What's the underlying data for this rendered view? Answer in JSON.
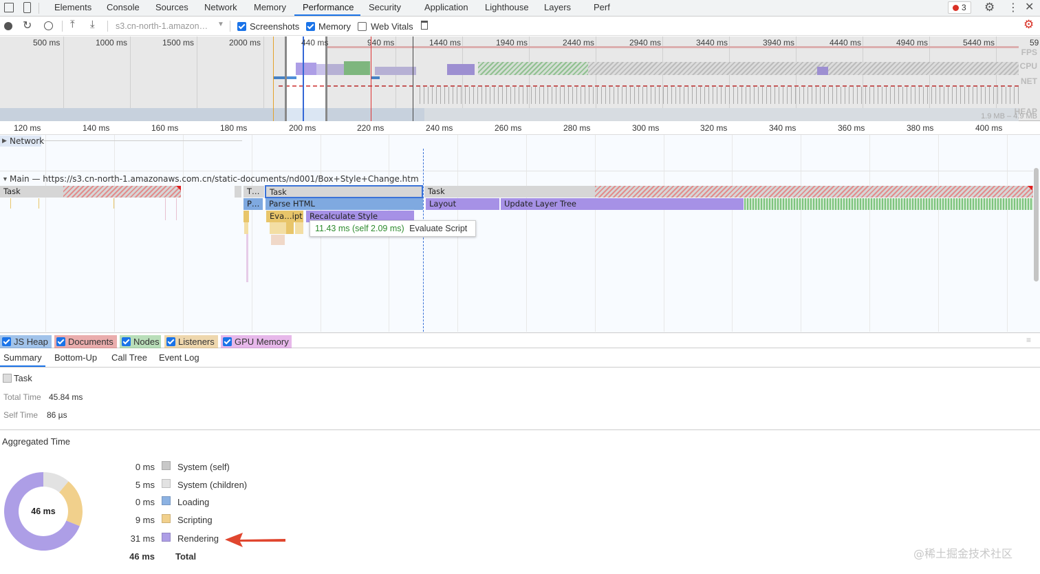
{
  "top_tabs": [
    "Elements",
    "Console",
    "Sources",
    "Network",
    "Memory",
    "Performance",
    "Security",
    "Application",
    "Lighthouse",
    "Layers",
    "Perf"
  ],
  "active_tab": "Performance",
  "error_count": "3",
  "toolbar": {
    "url_select": "s3.cn-north-1.amazon…",
    "screenshots_label": "Screenshots",
    "memory_label": "Memory",
    "web_vitals_label": "Web Vitals",
    "screenshots_checked": true,
    "memory_checked": true,
    "web_vitals_checked": false
  },
  "overview": {
    "ticks": [
      "500 ms",
      "1000 ms",
      "1500 ms",
      "2000 ms",
      "440 ms",
      "940 ms",
      "1440 ms",
      "1940 ms",
      "2440 ms",
      "2940 ms",
      "3440 ms",
      "3940 ms",
      "4440 ms",
      "4940 ms",
      "5440 ms",
      "59"
    ],
    "lanes": [
      "FPS",
      "CPU",
      "NET",
      "HEAP"
    ],
    "heap_range": "1.9 MB – 4.9 MB"
  },
  "ruler_ticks": [
    "120 ms",
    "140 ms",
    "160 ms",
    "180 ms",
    "200 ms",
    "220 ms",
    "240 ms",
    "260 ms",
    "280 ms",
    "300 ms",
    "320 ms",
    "340 ms",
    "360 ms",
    "380 ms",
    "400 ms"
  ],
  "network_track": "Network",
  "main_track": "Main — https://s3.cn-north-1.amazonaws.com.cn/static-documents/nd001/Box+Style+Change.htm",
  "flame": {
    "task1": "Task",
    "task_small": "T…",
    "task_selected": "Task",
    "task3": "Task",
    "parse_small": "P…",
    "parse_html": "Parse HTML",
    "layout": "Layout",
    "update_layer_tree": "Update Layer Tree",
    "eval_script": "Eva…ipt",
    "recalc_style": "Recalculate Style"
  },
  "tooltip": {
    "time": "11.43 ms (self 2.09 ms)",
    "name": "Evaluate Script"
  },
  "counters": [
    {
      "label": "JS Heap",
      "color": "#4e8ed8"
    },
    {
      "label": "Documents",
      "color": "#d86666"
    },
    {
      "label": "Nodes",
      "color": "#7cc27c"
    },
    {
      "label": "Listeners",
      "color": "#e0b466"
    },
    {
      "label": "GPU Memory",
      "color": "#d27ad8"
    }
  ],
  "bottom_tabs": [
    "Summary",
    "Bottom-Up",
    "Call Tree",
    "Event Log"
  ],
  "summary": {
    "title": "Task",
    "total_time_label": "Total Time",
    "total_time": "45.84 ms",
    "self_time_label": "Self Time",
    "self_time": "86 µs",
    "aggregated_label": "Aggregated Time",
    "donut_center": "46 ms",
    "legend": [
      {
        "ms": "0 ms",
        "label": "System (self)",
        "color": "#c8c8c8",
        "value": 0
      },
      {
        "ms": "5 ms",
        "label": "System (children)",
        "color": "#e2e2e2",
        "value": 5
      },
      {
        "ms": "0 ms",
        "label": "Loading",
        "color": "#8cb2e2",
        "value": 0
      },
      {
        "ms": "9 ms",
        "label": "Scripting",
        "color": "#f1d08c",
        "value": 9
      },
      {
        "ms": "31 ms",
        "label": "Rendering",
        "color": "#ad9ee6",
        "value": 31
      }
    ],
    "total_ms": "46 ms",
    "total_label": "Total"
  },
  "watermark": "@稀土掘金技术社区"
}
